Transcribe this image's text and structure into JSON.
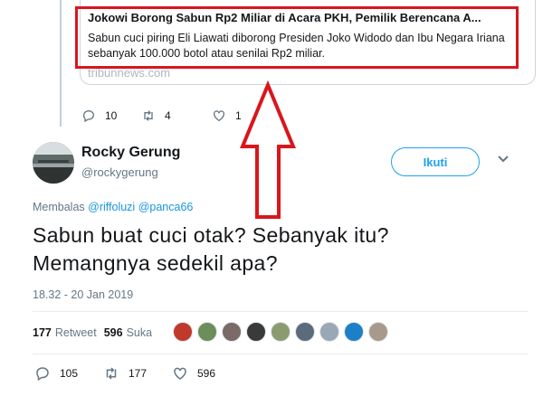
{
  "previous_tweet": {
    "card": {
      "title": "Jokowi Borong Sabun Rp2 Miliar di Acara PKH, Pemilik Berencana A...",
      "description": "Sabun cuci piring Eli Liawati diborong Presiden Joko Widodo dan Ibu Negara Iriana sebanyak 100.000 botol atau senilai Rp2 miliar.",
      "domain": "tribunnews.com"
    },
    "actions": {
      "replies": "10",
      "retweets": "4",
      "likes": "1"
    }
  },
  "tweet": {
    "author_name": "Rocky Gerung",
    "author_handle": "@rockygerung",
    "follow_label": "Ikuti",
    "replying_label": "Membalas",
    "replying_to": [
      "@riffoluzi",
      "@panca66"
    ],
    "text": "Sabun buat cuci otak? Sebanyak itu? Memangnya sedekil apa?",
    "timestamp": "18.32 - 20 Jan 2019",
    "retweet_count": "177",
    "retweet_label": "Retweet",
    "like_count": "596",
    "like_label": "Suka",
    "liker_colors": [
      "#c0392b",
      "#6b8e5a",
      "#7a6a68",
      "#3a3a3a",
      "#8c9a70",
      "#5b6b7b",
      "#9aa7b5",
      "#1e7fc9",
      "#a89a8a"
    ],
    "actions": {
      "replies": "105",
      "retweets": "177",
      "likes": "596"
    }
  },
  "colors": {
    "accent": "#1da1f2",
    "annotation": "#d9161c",
    "muted": "#657786"
  }
}
